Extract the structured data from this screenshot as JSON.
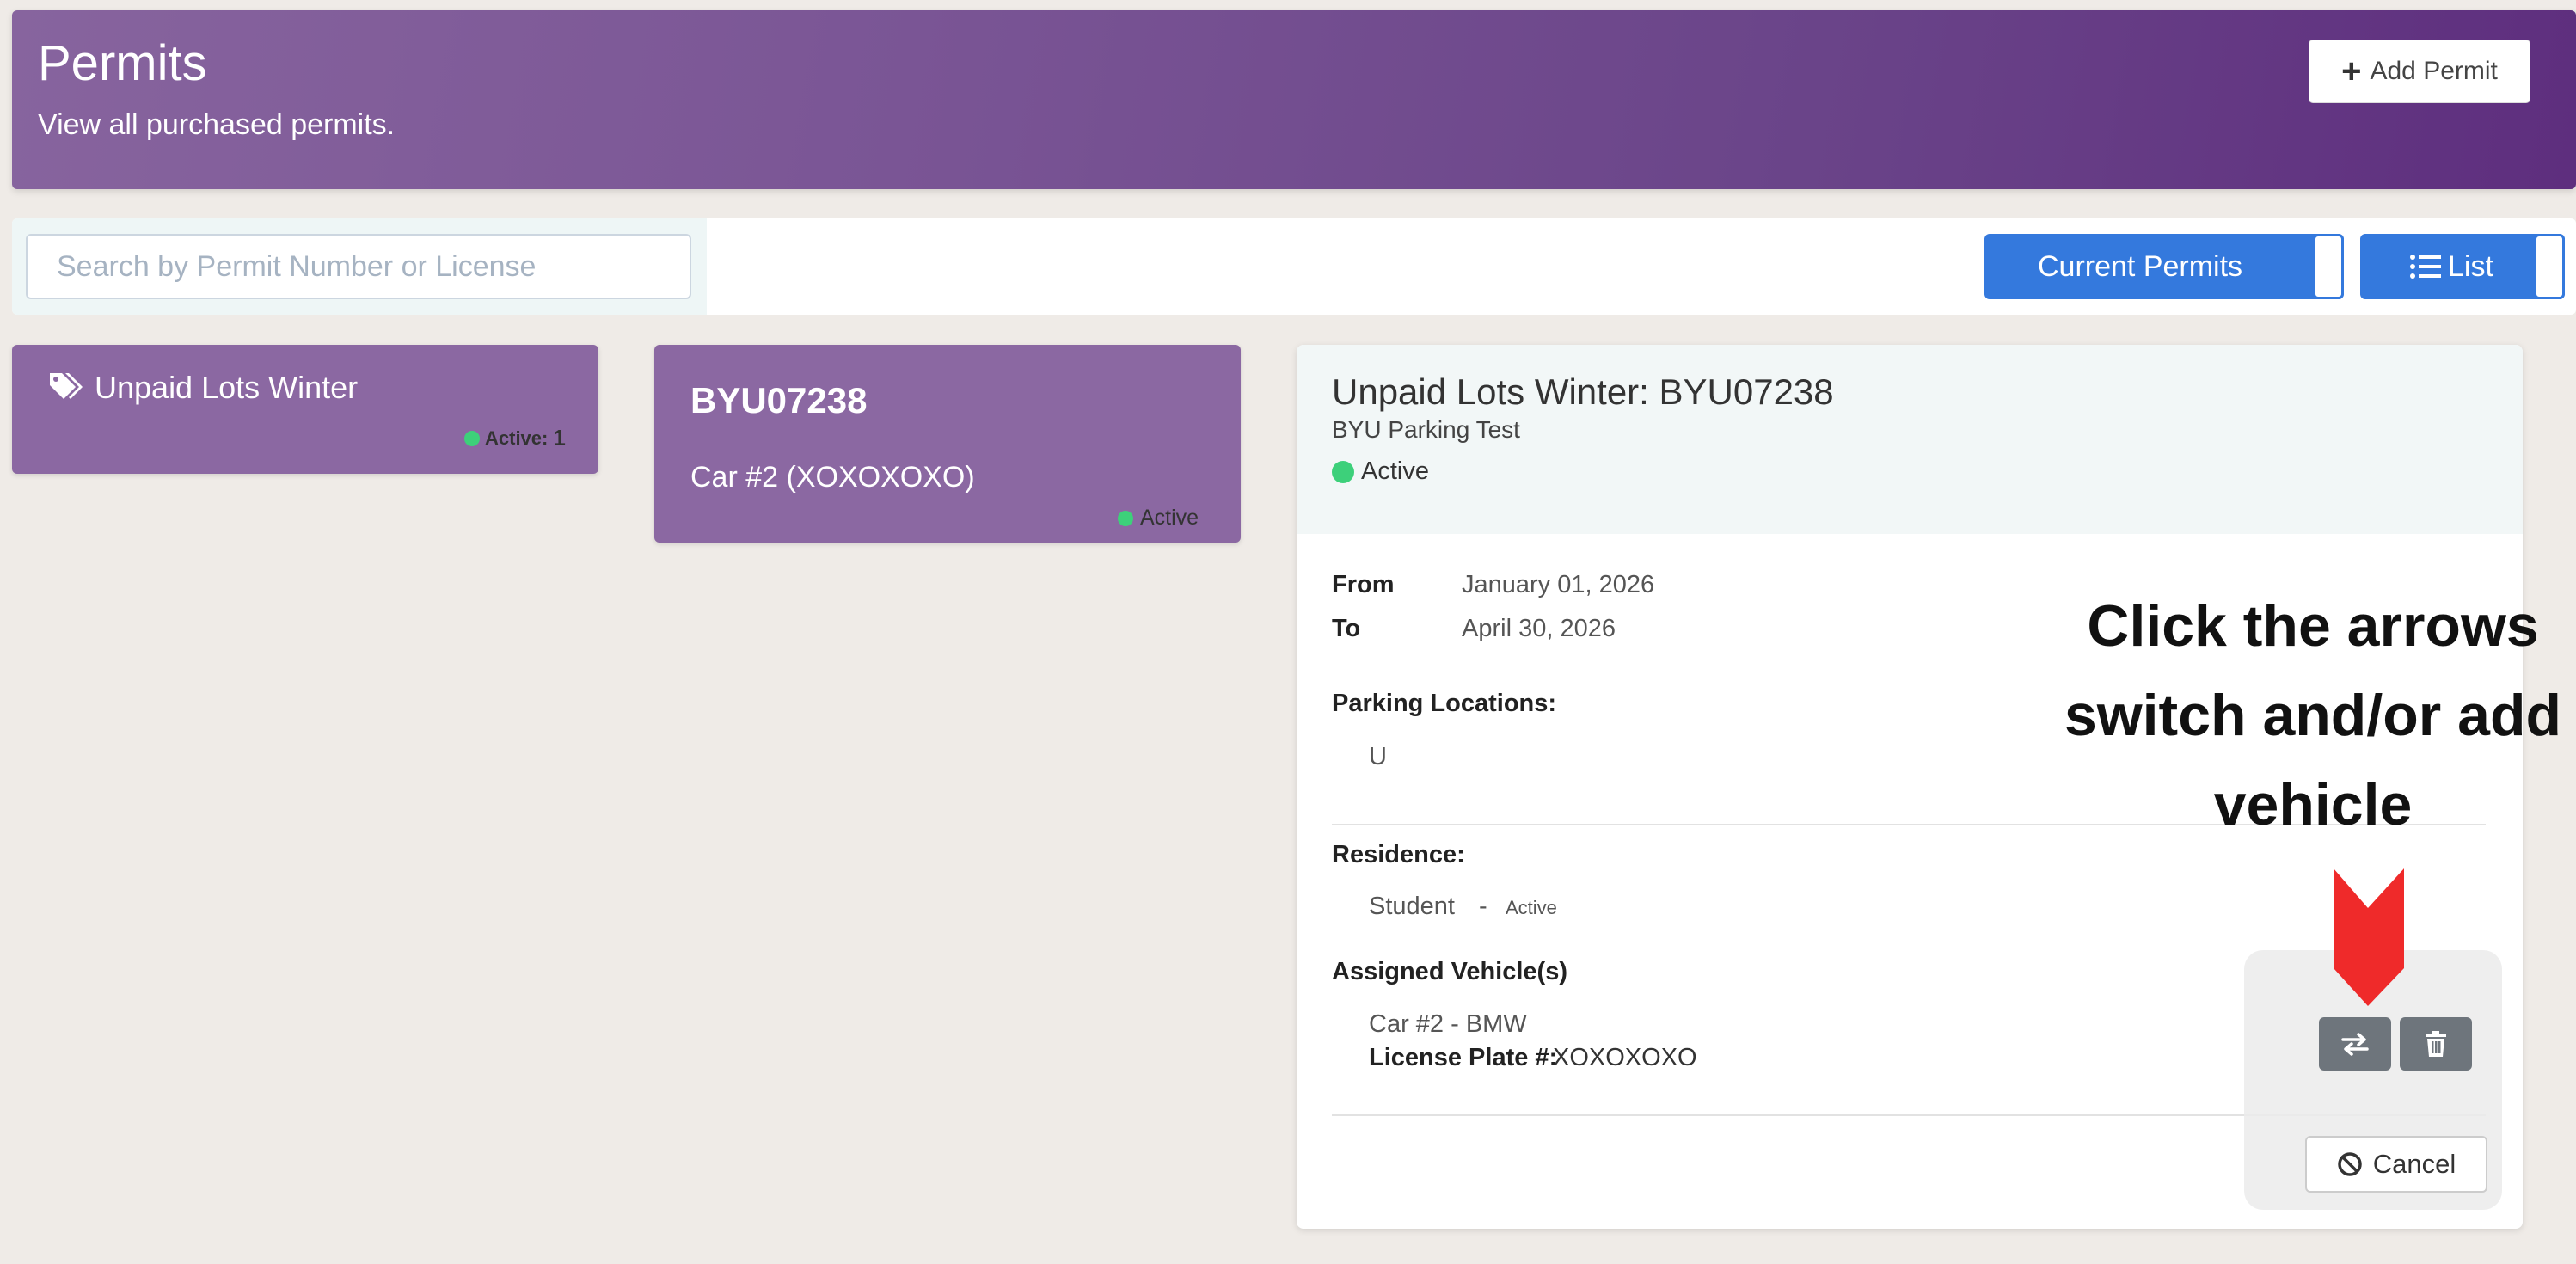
{
  "header": {
    "title": "Permits",
    "subtitle": "View all purchased permits.",
    "add_permit_label": "Add Permit"
  },
  "toolbar": {
    "search_placeholder": "Search by Permit Number or License",
    "current_permits_label": "Current Permits",
    "list_label": "List"
  },
  "group_card": {
    "name": "Unpaid Lots Winter",
    "status_label": "Active:",
    "status_count": "1"
  },
  "permit_card": {
    "number": "BYU07238",
    "vehicle": "Car #2 (XOXOXOXO)",
    "status": "Active"
  },
  "detail": {
    "title": "Unpaid Lots Winter: BYU07238",
    "lot": "BYU Parking Test",
    "status": "Active",
    "from_label": "From",
    "from_value": "January 01, 2026",
    "to_label": "To",
    "to_value": "April 30, 2026",
    "locations_label": "Parking Locations:",
    "location_value": "U",
    "residence_label": "Residence:",
    "residence_value": "Student",
    "residence_separator": "-",
    "residence_status": "Active",
    "vehicles_label": "Assigned Vehicle(s)",
    "vehicle_name": "Car #2 - BMW",
    "plate_label": "License Plate #:",
    "plate_value": "XOXOXOXO",
    "cancel_label": "Cancel"
  },
  "annotation": {
    "line1": "Click the arrows",
    "line2": "switch and/or add",
    "line3": "vehicle"
  },
  "colors": {
    "header_purple": "#6a4489",
    "card_purple": "#8b68a2",
    "accent_blue": "#3479dd",
    "active_green": "#3dd07a",
    "annotation_red": "#ef2a2a"
  },
  "icons": [
    "plus-icon",
    "tags-icon",
    "list-icon",
    "swap-arrows-icon",
    "trash-icon",
    "ban-icon",
    "down-arrow-icon"
  ]
}
